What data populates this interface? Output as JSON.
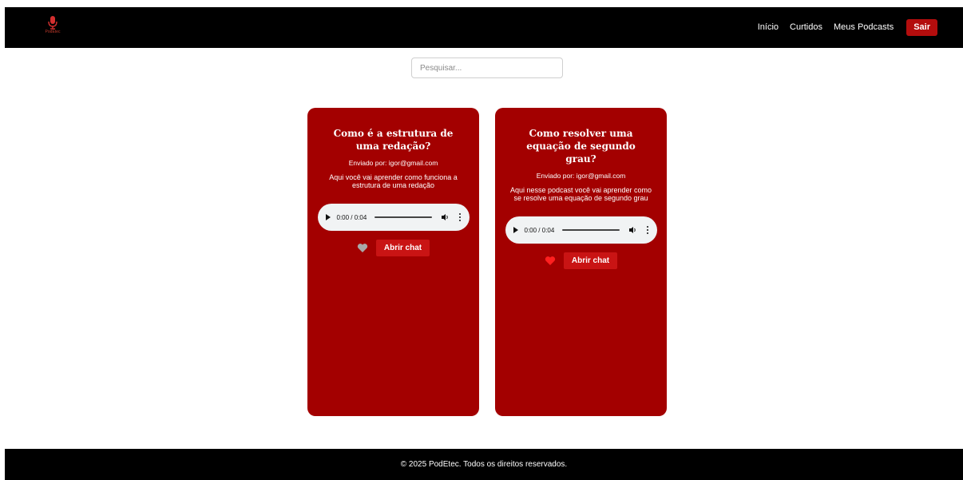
{
  "brand": {
    "name": "PodEtec",
    "logo_icon": "microphone-icon",
    "color": "#c0392b"
  },
  "nav": {
    "links": [
      "Início",
      "Curtidos",
      "Meus Podcasts"
    ],
    "logout_label": "Sair"
  },
  "search": {
    "placeholder": "Pesquisar...",
    "value": ""
  },
  "podcasts": [
    {
      "title": "Como é a estrutura de uma redação?",
      "author": "Enviado por: igor@gmail.com",
      "description": "Aqui você vai aprender como funciona a estrutura de uma redação",
      "audio_time": "0:00 / 0:04",
      "liked": false,
      "chat_label": "Abrir chat"
    },
    {
      "title": "Como resolver uma equação de segundo grau?",
      "author": "Enviado por: igor@gmail.com",
      "description": "Aqui nesse podcast você vai aprender como se resolve uma equação de segundo grau",
      "audio_time": "0:00 / 0:04",
      "liked": true,
      "chat_label": "Abrir chat"
    }
  ],
  "footer": {
    "text": "© 2025 PodEtec. Todos os direitos reservados."
  },
  "colors": {
    "card": "#a30000",
    "accent": "#b30d0d",
    "liked_heart": "#ff1f1f",
    "unliked_heart": "#a9a9a9"
  }
}
